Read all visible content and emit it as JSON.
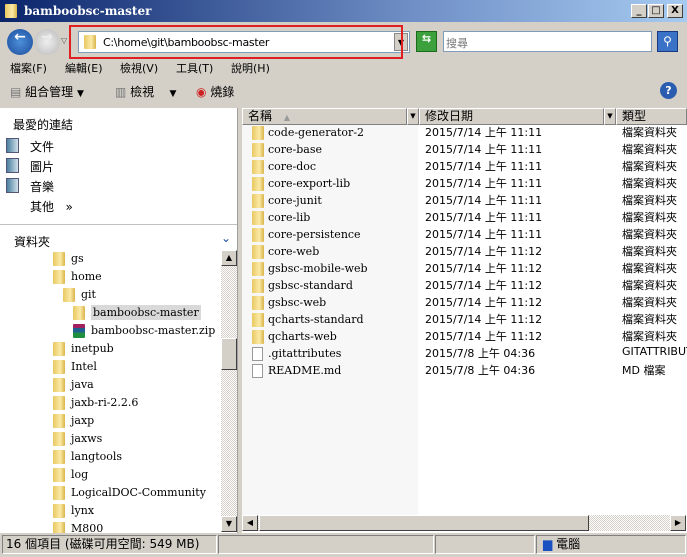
{
  "window": {
    "title": "bamboobsc-master",
    "minimize": "_",
    "maximize": "□",
    "close": "X"
  },
  "address": {
    "path": "C:\\home\\git\\bamboobsc-master",
    "search_placeholder": "搜尋"
  },
  "menu": [
    "檔案(F)",
    "編輯(E)",
    "檢視(V)",
    "工具(T)",
    "說明(H)"
  ],
  "toolbar": {
    "organize": "組合管理",
    "views": "檢視",
    "burn": "燒錄"
  },
  "favorites": {
    "title": "最愛的連結",
    "items": [
      "文件",
      "圖片",
      "音樂"
    ],
    "more": "其他",
    "more_glyph": "»"
  },
  "folders": {
    "title": "資料夾",
    "tree": [
      {
        "label": "gs",
        "level": 0
      },
      {
        "label": "home",
        "level": 0
      },
      {
        "label": "git",
        "level": 1
      },
      {
        "label": "bamboobsc-master",
        "level": 2,
        "selected": true
      },
      {
        "label": "bamboobsc-master.zip",
        "level": 2,
        "zip": true
      },
      {
        "label": "inetpub",
        "level": 0
      },
      {
        "label": "Intel",
        "level": 0
      },
      {
        "label": "java",
        "level": 0
      },
      {
        "label": "jaxb-ri-2.2.6",
        "level": 0
      },
      {
        "label": "jaxp",
        "level": 0
      },
      {
        "label": "jaxws",
        "level": 0
      },
      {
        "label": "langtools",
        "level": 0
      },
      {
        "label": "log",
        "level": 0
      },
      {
        "label": "LogicalDOC-Community",
        "level": 0
      },
      {
        "label": "lynx",
        "level": 0
      },
      {
        "label": "M800",
        "level": 0
      }
    ]
  },
  "columns": {
    "name": "名稱",
    "date": "修改日期",
    "type": "類型"
  },
  "files": [
    {
      "name": "code-generator-2",
      "date": "2015/7/14 上午 11:11",
      "type": "檔案資料夾",
      "folder": true
    },
    {
      "name": "core-base",
      "date": "2015/7/14 上午 11:11",
      "type": "檔案資料夾",
      "folder": true
    },
    {
      "name": "core-doc",
      "date": "2015/7/14 上午 11:11",
      "type": "檔案資料夾",
      "folder": true
    },
    {
      "name": "core-export-lib",
      "date": "2015/7/14 上午 11:11",
      "type": "檔案資料夾",
      "folder": true
    },
    {
      "name": "core-junit",
      "date": "2015/7/14 上午 11:11",
      "type": "檔案資料夾",
      "folder": true
    },
    {
      "name": "core-lib",
      "date": "2015/7/14 上午 11:11",
      "type": "檔案資料夾",
      "folder": true
    },
    {
      "name": "core-persistence",
      "date": "2015/7/14 上午 11:11",
      "type": "檔案資料夾",
      "folder": true
    },
    {
      "name": "core-web",
      "date": "2015/7/14 上午 11:12",
      "type": "檔案資料夾",
      "folder": true
    },
    {
      "name": "gsbsc-mobile-web",
      "date": "2015/7/14 上午 11:12",
      "type": "檔案資料夾",
      "folder": true
    },
    {
      "name": "gsbsc-standard",
      "date": "2015/7/14 上午 11:12",
      "type": "檔案資料夾",
      "folder": true
    },
    {
      "name": "gsbsc-web",
      "date": "2015/7/14 上午 11:12",
      "type": "檔案資料夾",
      "folder": true
    },
    {
      "name": "qcharts-standard",
      "date": "2015/7/14 上午 11:12",
      "type": "檔案資料夾",
      "folder": true
    },
    {
      "name": "qcharts-web",
      "date": "2015/7/14 上午 11:12",
      "type": "檔案資料夾",
      "folder": true
    },
    {
      "name": ".gitattributes",
      "date": "2015/7/8 上午 04:36",
      "type": "GITATTRIBUTES",
      "folder": false
    },
    {
      "name": "README.md",
      "date": "2015/7/8 上午 04:36",
      "type": "MD 檔案",
      "folder": false
    }
  ],
  "status": {
    "items": "16 個項目 (磁碟可用空間: 549 MB)",
    "location": "電腦"
  }
}
